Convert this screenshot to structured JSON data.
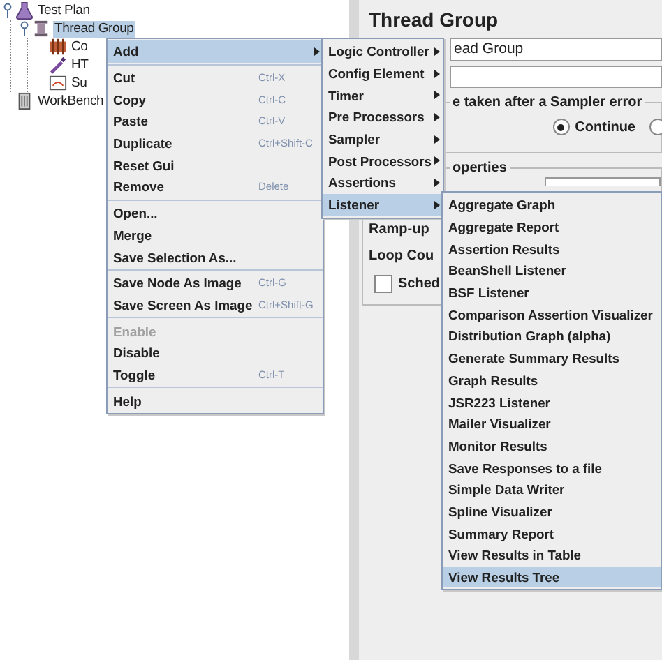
{
  "tree": [
    {
      "label": "Test Plan",
      "kind": "flask",
      "selected": false,
      "expanded": true,
      "children": [
        {
          "label": "Thread Group",
          "kind": "spool",
          "selected": true,
          "expanded": true,
          "children": [
            {
              "label": "Co",
              "kind": "config",
              "selected": false
            },
            {
              "label": "HT",
              "kind": "pipette",
              "selected": false
            },
            {
              "label": "Su",
              "kind": "report",
              "selected": false
            }
          ]
        }
      ]
    },
    {
      "label": "WorkBench",
      "kind": "cabinet",
      "selected": false
    }
  ],
  "editor": {
    "title": "Thread Group",
    "name_value": "ead Group",
    "error_group": {
      "legend": "e taken after a Sampler error",
      "options": [
        {
          "label": "Continue",
          "selected": true
        },
        {
          "selected": false
        }
      ]
    },
    "properties": {
      "legend": "operties",
      "rows": [
        {
          "label": "Ramp-up"
        },
        {
          "label": "Loop Cou"
        }
      ],
      "scheduler": {
        "label": "Sched",
        "checked": false
      }
    }
  },
  "context_menu": {
    "sections": [
      [
        {
          "label": "Add",
          "selected": true,
          "disabled": false,
          "submenu": true
        }
      ],
      [
        {
          "label": "Cut",
          "shortcut": "Ctrl-X",
          "selected": false,
          "disabled": false,
          "submenu": false
        },
        {
          "label": "Copy",
          "shortcut": "Ctrl-C",
          "selected": false,
          "disabled": false,
          "submenu": false
        },
        {
          "label": "Paste",
          "shortcut": "Ctrl-V",
          "selected": false,
          "disabled": false,
          "submenu": false
        },
        {
          "label": "Duplicate",
          "shortcut": "Ctrl+Shift-C",
          "selected": false,
          "disabled": false,
          "submenu": false
        },
        {
          "label": "Reset Gui",
          "selected": false,
          "disabled": false,
          "submenu": false
        },
        {
          "label": "Remove",
          "shortcut": "Delete",
          "selected": false,
          "disabled": false,
          "submenu": false
        }
      ],
      [
        {
          "label": "Open...",
          "selected": false,
          "disabled": false,
          "submenu": false
        },
        {
          "label": "Merge",
          "selected": false,
          "disabled": false,
          "submenu": false
        },
        {
          "label": "Save Selection As...",
          "selected": false,
          "disabled": false,
          "submenu": false
        }
      ],
      [
        {
          "label": "Save Node As Image",
          "shortcut": "Ctrl-G",
          "selected": false,
          "disabled": false,
          "submenu": false
        },
        {
          "label": "Save Screen As Image",
          "shortcut": "Ctrl+Shift-G",
          "selected": false,
          "disabled": false,
          "submenu": false
        }
      ],
      [
        {
          "label": "Enable",
          "selected": false,
          "disabled": true,
          "submenu": false
        },
        {
          "label": "Disable",
          "selected": false,
          "disabled": false,
          "submenu": false
        },
        {
          "label": "Toggle",
          "shortcut": "Ctrl-T",
          "selected": false,
          "disabled": false,
          "submenu": false
        }
      ],
      [
        {
          "label": "Help",
          "selected": false,
          "disabled": false,
          "submenu": false
        }
      ]
    ]
  },
  "add_submenu": {
    "sections": [
      [
        {
          "label": "Logic Controller",
          "selected": false,
          "submenu": true
        },
        {
          "label": "Config Element",
          "selected": false,
          "submenu": true
        },
        {
          "label": "Timer",
          "selected": false,
          "submenu": true
        },
        {
          "label": "Pre Processors",
          "selected": false,
          "submenu": true
        },
        {
          "label": "Sampler",
          "selected": false,
          "submenu": true
        },
        {
          "label": "Post Processors",
          "selected": false,
          "submenu": true
        },
        {
          "label": "Assertions",
          "selected": false,
          "submenu": true
        },
        {
          "label": "Listener",
          "selected": true,
          "submenu": true
        }
      ]
    ]
  },
  "listener_submenu": {
    "sections": [
      [
        {
          "label": "Aggregate Graph",
          "selected": false
        },
        {
          "label": "Aggregate Report",
          "selected": false
        },
        {
          "label": "Assertion Results",
          "selected": false
        },
        {
          "label": "BeanShell Listener",
          "selected": false
        },
        {
          "label": "BSF Listener",
          "selected": false
        },
        {
          "label": "Comparison Assertion Visualizer",
          "selected": false
        },
        {
          "label": "Distribution Graph (alpha)",
          "selected": false
        },
        {
          "label": "Generate Summary Results",
          "selected": false
        },
        {
          "label": "Graph Results",
          "selected": false
        },
        {
          "label": "JSR223 Listener",
          "selected": false
        },
        {
          "label": "Mailer Visualizer",
          "selected": false
        },
        {
          "label": "Monitor Results",
          "selected": false
        },
        {
          "label": "Save Responses to a file",
          "selected": false
        },
        {
          "label": "Simple Data Writer",
          "selected": false
        },
        {
          "label": "Spline Visualizer",
          "selected": false
        },
        {
          "label": "Summary Report",
          "selected": false
        },
        {
          "label": "View Results in Table",
          "selected": false
        },
        {
          "label": "View Results Tree",
          "selected": true
        }
      ]
    ]
  }
}
